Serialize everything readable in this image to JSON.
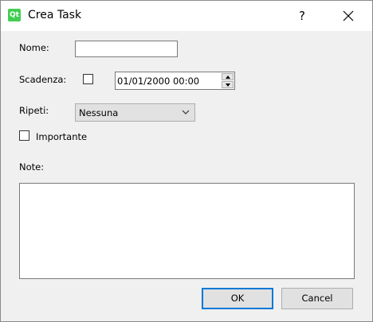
{
  "window": {
    "title": "Crea Task",
    "app_icon": "qt-logo-icon",
    "app_icon_text": "Qt",
    "help_label": "?",
    "close_icon": "close-icon"
  },
  "form": {
    "name_label": "Nome:",
    "name_value": "",
    "deadline_label": "Scadenza:",
    "deadline_checked": false,
    "deadline_datetime": "01/01/2000 00:00",
    "repeat_label": "Ripeti:",
    "repeat_selected": "Nessuna",
    "important_label": "Importante",
    "important_checked": false,
    "notes_label": "Note:",
    "notes_value": ""
  },
  "buttons": {
    "ok_label": "OK",
    "cancel_label": "Cancel"
  },
  "colors": {
    "accent": "#0078d7",
    "qt_green": "#41cd52",
    "background": "#f0f0f0"
  }
}
